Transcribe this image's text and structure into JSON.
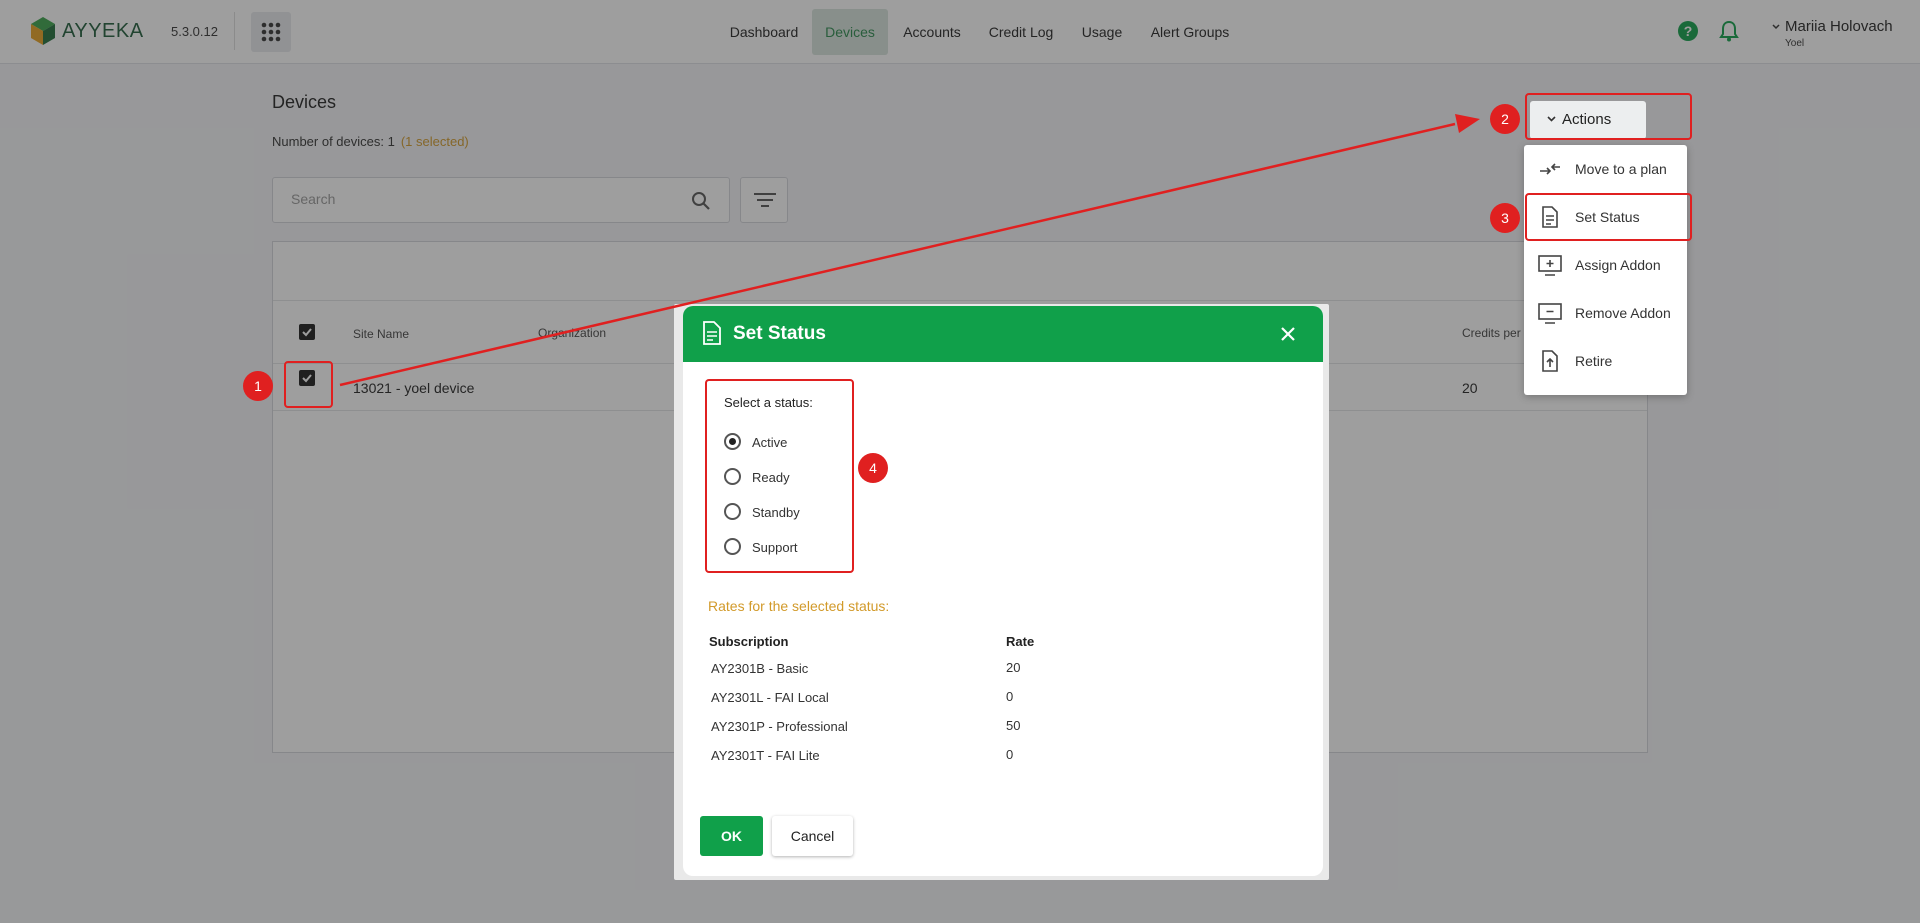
{
  "header": {
    "logo_text": "AYYEKA",
    "version": "5.3.0.12",
    "nav": [
      "Dashboard",
      "Devices",
      "Accounts",
      "Credit Log",
      "Usage",
      "Alert Groups"
    ],
    "active_nav": "Devices",
    "user_name": "Mariia Holovach",
    "user_org": "Yoel"
  },
  "page": {
    "title": "Devices",
    "count_label": "Number of devices: 1",
    "selected_label": "(1 selected)",
    "search_placeholder": "Search"
  },
  "table": {
    "headers": [
      "Site Name",
      "Organization",
      "Credits per"
    ],
    "rows": [
      {
        "site_name": "13021 - yoel device",
        "credits": "20"
      }
    ]
  },
  "actions": {
    "button_label": "Actions",
    "items": [
      "Move to a plan",
      "Set Status",
      "Assign Addon",
      "Remove Addon",
      "Retire"
    ]
  },
  "dialog": {
    "title": "Set Status",
    "select_label": "Select a status:",
    "statuses": [
      "Active",
      "Ready",
      "Standby",
      "Support"
    ],
    "selected_status": "Active",
    "rates_title": "Rates for the selected status:",
    "rate_headers": [
      "Subscription",
      "Rate"
    ],
    "rates": [
      {
        "subscription": "AY2301B - Basic",
        "rate": "20"
      },
      {
        "subscription": "AY2301L - FAI Local",
        "rate": "0"
      },
      {
        "subscription": "AY2301P - Professional",
        "rate": "50"
      },
      {
        "subscription": "AY2301T - FAI Lite",
        "rate": "0"
      }
    ],
    "ok_label": "OK",
    "cancel_label": "Cancel"
  },
  "annotations": {
    "badges": [
      "1",
      "2",
      "3",
      "4"
    ],
    "color": "#e02020"
  },
  "colors": {
    "brand_green": "#10a04a",
    "accent_amber": "#d29a2a"
  }
}
